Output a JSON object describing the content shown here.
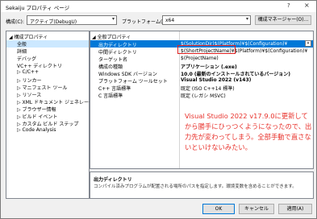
{
  "window": {
    "title": "Sekaiju プロパティ ページ",
    "help_glyph": "?",
    "close_glyph": "×"
  },
  "toolbar": {
    "config_label": "構成(C):",
    "config_value": "アクティブ(DebugU)",
    "platform_label": "プラットフォーム(P):",
    "platform_value": "x64",
    "manager_button": "構成マネージャー(O)..."
  },
  "tree": {
    "items": [
      {
        "label": "◢ 構成プロパティ",
        "selected": false,
        "indent": 0
      },
      {
        "label": "全般",
        "selected": true,
        "indent": 1
      },
      {
        "label": "詳細",
        "selected": false,
        "indent": 1
      },
      {
        "label": "デバッグ",
        "selected": false,
        "indent": 1
      },
      {
        "label": "VC++ ディレクトリ",
        "selected": false,
        "indent": 1
      },
      {
        "label": "▷ C/C++",
        "selected": false,
        "indent": 1
      },
      {
        "label": "▷ リンカー",
        "selected": false,
        "indent": 1
      },
      {
        "label": "▷ マニフェスト ツール",
        "selected": false,
        "indent": 1
      },
      {
        "label": "▷ リソース",
        "selected": false,
        "indent": 1
      },
      {
        "label": "▷ XML ドキュメント ジェネレーター",
        "selected": false,
        "indent": 1
      },
      {
        "label": "▷ ブラウザー情報",
        "selected": false,
        "indent": 1
      },
      {
        "label": "▷ ビルド イベント",
        "selected": false,
        "indent": 1
      },
      {
        "label": "▷ カスタム ビルド ステップ",
        "selected": false,
        "indent": 1
      },
      {
        "label": "▷ Code Analysis",
        "selected": false,
        "indent": 1
      }
    ]
  },
  "grid": {
    "section": "◢ 全般プロパティ",
    "rows": [
      {
        "name": "出力ディレクトリ",
        "value": "$(SolutionDir)$(Platform)¥$(Configuration)¥",
        "selected": true,
        "bold": false
      },
      {
        "name": "中間ディレクトリ",
        "value": "$(ShortProjectName)¥$(Platform)¥$(Configuration)¥",
        "selected": false,
        "bold": false
      },
      {
        "name": "ターゲット名",
        "value": "$(ProjectName)",
        "selected": false,
        "bold": false
      },
      {
        "name": "構成の種類",
        "value": "アプリケーション (.exe)",
        "selected": false,
        "bold": true
      },
      {
        "name": "Windows SDK バージョン",
        "value": "10.0 (最新のインストールされているバージョン)",
        "selected": false,
        "bold": true
      },
      {
        "name": "プラットフォーム ツールセット",
        "value": "Visual Studio 2022 (v143)",
        "selected": false,
        "bold": true
      },
      {
        "name": "C++ 言語標準",
        "value": "既定 (ISO C++14 標準)",
        "selected": false,
        "bold": false
      },
      {
        "name": "C 言語標準",
        "value": "既定 (レガシ MSVC)",
        "selected": false,
        "bold": false
      }
    ]
  },
  "annotation": {
    "text": "Visual Studio 2022 v17.9.0に更新してから勝手にひっつくようになったので、出力先が変わってしまう。全部手動で直さないといけないみたい。"
  },
  "description": {
    "heading": "出力ディレクトリ",
    "text": "コンパイル済みプログラムが配置される場所のパスを指定します。環境変数を含めることができます。"
  },
  "buttons": {
    "ok": "OK",
    "cancel": "キャンセル",
    "apply": "適用(A)"
  },
  "colors": {
    "selection": "#0078d7",
    "annotation": "#e8302a",
    "tree_selection": "#cce8ff"
  }
}
